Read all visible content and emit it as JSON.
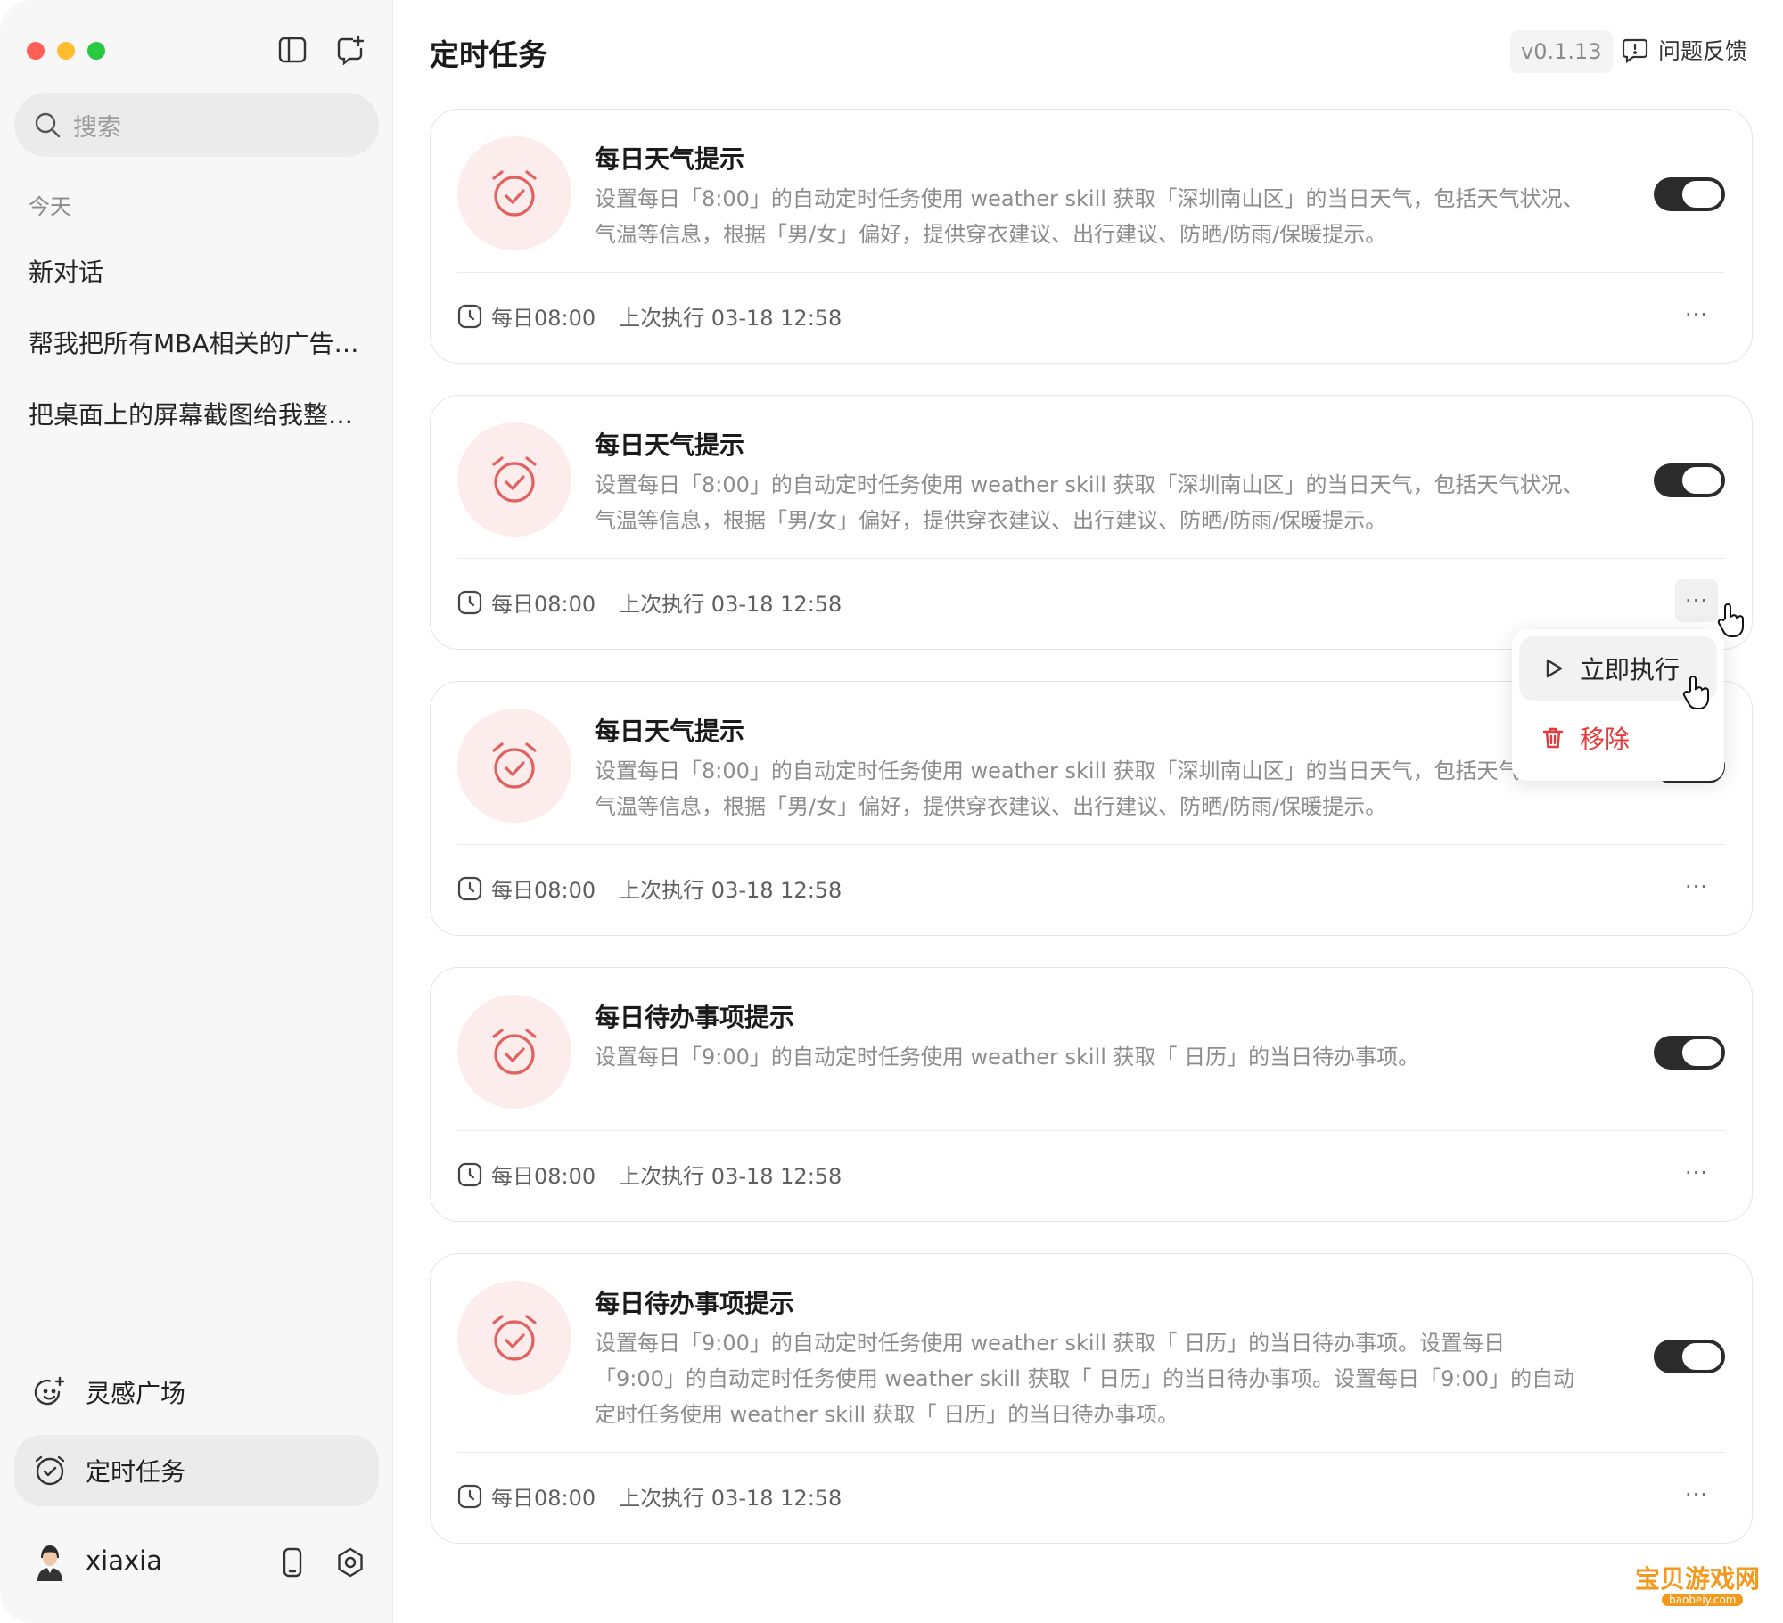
{
  "sidebar": {
    "search_placeholder": "搜索",
    "section_today": "今天",
    "conversations": [
      "新对话",
      "帮我把所有MBA相关的广告…",
      "把桌面上的屏幕截图给我整…"
    ],
    "nav": {
      "inspiration": "灵感广场",
      "scheduled": "定时任务"
    },
    "user": {
      "name": "xiaxia"
    }
  },
  "header": {
    "title": "定时任务",
    "version": "v0.1.13",
    "feedback": "问题反馈"
  },
  "tasks": [
    {
      "title": "每日天气提示",
      "description": "设置每日「8:00」的自动定时任务使用 weather skill 获取「深圳南山区」的当日天气，包括天气状况、气温等信息，根据「男/女」偏好，提供穿衣建议、出行建议、防晒/防雨/保暖提示。",
      "schedule": "每日08:00",
      "last_run": "上次执行 03-18 12:58",
      "enabled": true
    },
    {
      "title": "每日天气提示",
      "description": "设置每日「8:00」的自动定时任务使用 weather skill 获取「深圳南山区」的当日天气，包括天气状况、气温等信息，根据「男/女」偏好，提供穿衣建议、出行建议、防晒/防雨/保暖提示。",
      "schedule": "每日08:00",
      "last_run": "上次执行 03-18 12:58",
      "enabled": true
    },
    {
      "title": "每日天气提示",
      "description": "设置每日「8:00」的自动定时任务使用 weather skill 获取「深圳南山区」的当日天气，包括天气状况、气温等信息，根据「男/女」偏好，提供穿衣建议、出行建议、防晒/防雨/保暖提示。",
      "schedule": "每日08:00",
      "last_run": "上次执行 03-18 12:58",
      "enabled": true
    },
    {
      "title": "每日待办事项提示",
      "description": "设置每日「9:00」的自动定时任务使用 weather skill 获取「 日历」的当日待办事项。",
      "schedule": "每日08:00",
      "last_run": "上次执行 03-18 12:58",
      "enabled": true
    },
    {
      "title": "每日待办事项提示",
      "description": "设置每日「9:00」的自动定时任务使用 weather skill 获取「 日历」的当日待办事项。设置每日「9:00」的自动定时任务使用 weather skill 获取「 日历」的当日待办事项。设置每日「9:00」的自动定时任务使用 weather skill 获取「 日历」的当日待办事项。",
      "schedule": "每日08:00",
      "last_run": "上次执行 03-18 12:58",
      "enabled": true
    }
  ],
  "more_label": "···",
  "menu": {
    "run_now": "立即执行",
    "remove": "移除"
  },
  "watermark": {
    "text": "宝贝游戏网",
    "url": "baobeiy.com"
  },
  "colors": {
    "accent_red": "#e23b3b",
    "icon_bg": "#fdecec",
    "toggle_on": "#2b2b2b"
  }
}
